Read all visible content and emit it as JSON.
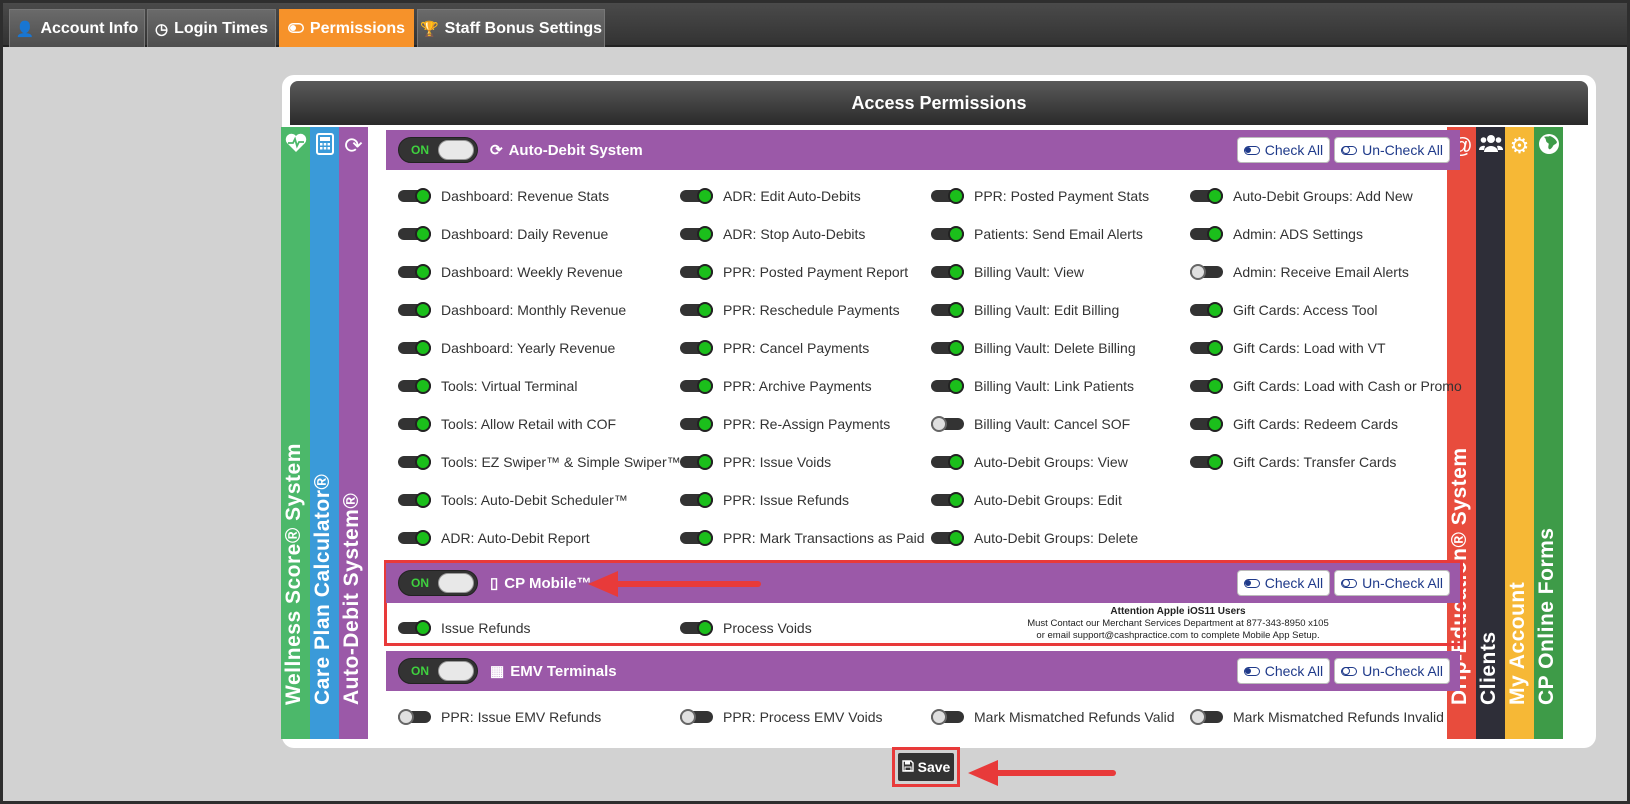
{
  "tabs": [
    {
      "label": "Account Info",
      "icon": "user-icon",
      "active": false
    },
    {
      "label": "Login Times",
      "icon": "clock-icon",
      "active": false
    },
    {
      "label": "Permissions",
      "icon": "toggle-icon",
      "active": true
    },
    {
      "label": "Staff Bonus Settings",
      "icon": "trophy-icon",
      "active": false
    }
  ],
  "panel": {
    "title": "Access Permissions"
  },
  "strips": {
    "left": [
      {
        "label": "Wellness Score® System",
        "icon": "heartbeat-icon",
        "color": "#4cb86a"
      },
      {
        "label": "Care Plan Calculator®",
        "icon": "calculator-icon",
        "color": "#3a9ad9"
      },
      {
        "label": "Auto-Debit System®",
        "icon": "refresh-icon",
        "color": "#9b59a8"
      }
    ],
    "right": [
      {
        "label": "Drip-Education® System",
        "icon": "at-icon",
        "color": "#e84c3d"
      },
      {
        "label": "Clients",
        "icon": "users-icon",
        "color": "#2e2e38"
      },
      {
        "label": "My Account",
        "icon": "gear-icon",
        "color": "#f6b836"
      },
      {
        "label": "CP Online Forms",
        "icon": "globe-icon",
        "color": "#3e9b48"
      }
    ]
  },
  "common": {
    "on_label": "ON",
    "check_all": "Check All",
    "uncheck_all": "Un-Check All"
  },
  "sections": {
    "auto_debit": {
      "title": "Auto-Debit System",
      "items": [
        [
          {
            "label": "Dashboard: Revenue Stats",
            "on": true
          },
          {
            "label": "Dashboard: Daily Revenue",
            "on": true
          },
          {
            "label": "Dashboard: Weekly Revenue",
            "on": true
          },
          {
            "label": "Dashboard: Monthly Revenue",
            "on": true
          },
          {
            "label": "Dashboard: Yearly Revenue",
            "on": true
          },
          {
            "label": "Tools: Virtual Terminal",
            "on": true
          },
          {
            "label": "Tools: Allow Retail with COF",
            "on": true
          },
          {
            "label": "Tools: EZ Swiper™ & Simple Swiper™",
            "on": true
          },
          {
            "label": "Tools: Auto-Debit Scheduler™",
            "on": true
          },
          {
            "label": "ADR: Auto-Debit Report",
            "on": true
          }
        ],
        [
          {
            "label": "ADR: Edit Auto-Debits",
            "on": true
          },
          {
            "label": "ADR: Stop Auto-Debits",
            "on": true
          },
          {
            "label": "PPR: Posted Payment Report",
            "on": true
          },
          {
            "label": "PPR: Reschedule Payments",
            "on": true
          },
          {
            "label": "PPR: Cancel Payments",
            "on": true
          },
          {
            "label": "PPR: Archive Payments",
            "on": true
          },
          {
            "label": "PPR: Re-Assign Payments",
            "on": true
          },
          {
            "label": "PPR: Issue Voids",
            "on": true
          },
          {
            "label": "PPR: Issue Refunds",
            "on": true
          },
          {
            "label": "PPR: Mark Transactions as Paid",
            "on": true
          }
        ],
        [
          {
            "label": "PPR: Posted Payment Stats",
            "on": true
          },
          {
            "label": "Patients: Send Email Alerts",
            "on": true
          },
          {
            "label": "Billing Vault: View",
            "on": true
          },
          {
            "label": "Billing Vault: Edit Billing",
            "on": true
          },
          {
            "label": "Billing Vault: Delete Billing",
            "on": true
          },
          {
            "label": "Billing Vault: Link Patients",
            "on": true
          },
          {
            "label": "Billing Vault: Cancel SOF",
            "on": false
          },
          {
            "label": "Auto-Debit Groups: View",
            "on": true
          },
          {
            "label": "Auto-Debit Groups: Edit",
            "on": true
          },
          {
            "label": "Auto-Debit Groups: Delete",
            "on": true
          }
        ],
        [
          {
            "label": "Auto-Debit Groups: Add New",
            "on": true
          },
          {
            "label": "Admin: ADS Settings",
            "on": true
          },
          {
            "label": "Admin: Receive Email Alerts",
            "on": false
          },
          {
            "label": "Gift Cards: Access Tool",
            "on": true
          },
          {
            "label": "Gift Cards: Load with VT",
            "on": true
          },
          {
            "label": "Gift Cards: Load with Cash or Promo",
            "on": true
          },
          {
            "label": "Gift Cards: Redeem Cards",
            "on": true
          },
          {
            "label": "Gift Cards: Transfer Cards",
            "on": true
          }
        ]
      ]
    },
    "cp_mobile": {
      "title": "CP Mobile™",
      "items": [
        {
          "label": "Issue Refunds",
          "on": true
        },
        {
          "label": "Process Voids",
          "on": true
        }
      ],
      "notice": {
        "title": "Attention Apple iOS11 Users",
        "line1": "Must Contact our Merchant Services Department at 877-343-8950 x105",
        "line2": "or email support@cashpractice.com to complete Mobile App Setup."
      }
    },
    "emv": {
      "title": "EMV Terminals",
      "items": [
        {
          "label": "PPR: Issue EMV Refunds",
          "on": false
        },
        {
          "label": "PPR: Process EMV Voids",
          "on": false
        },
        {
          "label": "Mark Mismatched Refunds Valid",
          "on": false
        },
        {
          "label": "Mark Mismatched Refunds Invalid",
          "on": false
        }
      ]
    }
  },
  "save": {
    "label": "Save"
  },
  "colors": {
    "accent": "#f6922a",
    "section": "#9b59a8",
    "highlight": "#e83a3a"
  }
}
